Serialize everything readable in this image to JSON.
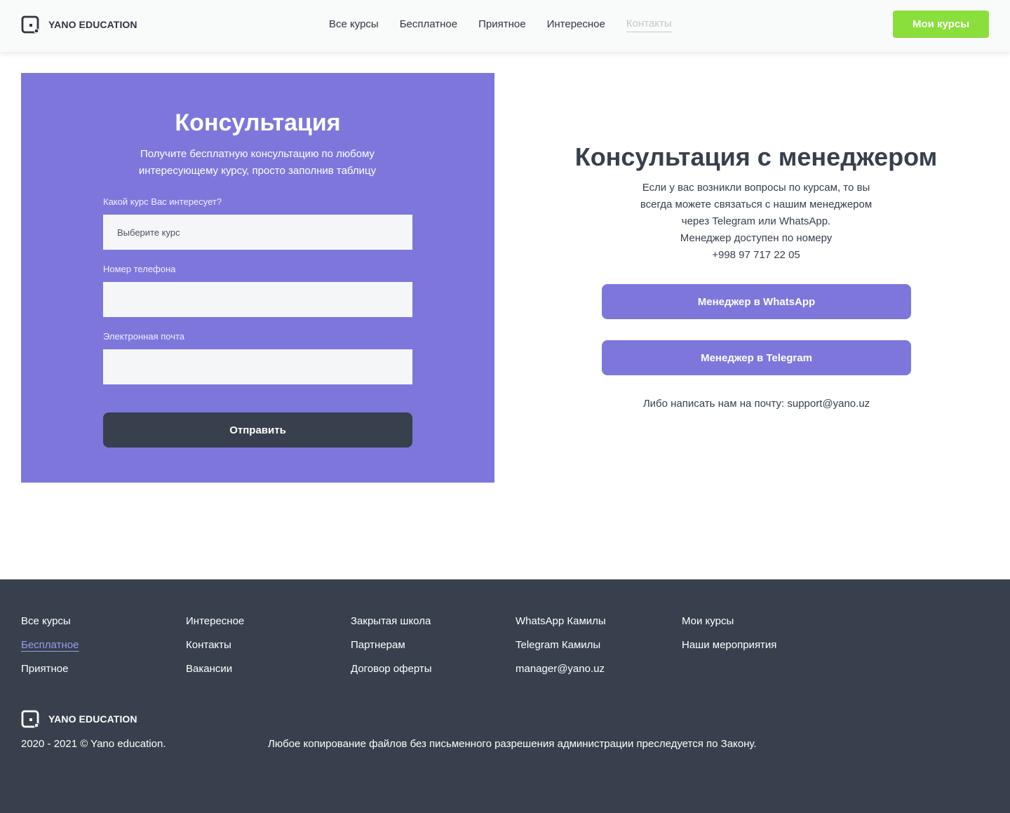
{
  "header": {
    "logo_text": "YANO EDUCATION",
    "nav": [
      {
        "label": "Все курсы"
      },
      {
        "label": "Бесплатное"
      },
      {
        "label": "Приятное"
      },
      {
        "label": "Интересное"
      },
      {
        "label": "Контакты",
        "active": true
      }
    ],
    "my_courses_label": "Мои курсы"
  },
  "form": {
    "title": "Консультация",
    "subtitle": "Получите бесплатную консультацию по любому интересующему курсу, просто заполнив таблицу",
    "course_label": "Какой курс Вас интересует?",
    "course_placeholder": "Выберите курс",
    "phone_label": "Номер телефона",
    "phone_value": "",
    "email_label": "Электронная почта",
    "email_value": "",
    "submit_label": "Отправить"
  },
  "manager": {
    "title": "Консультация с менеджером",
    "text_lines": [
      "Если у вас возникли вопросы по курсам, то вы",
      "всегда можете связаться с нашим менеджером",
      "через Telegram или WhatsApp.",
      "Менеджер доступен по номеру",
      "+998 97 717 22 05"
    ],
    "whatsapp_label": "Менеджер в WhatsApp",
    "telegram_label": "Менеджер в Telegram",
    "mail_text": "Либо написать нам на почту: support@yano.uz"
  },
  "footer": {
    "columns": [
      [
        "Все курсы",
        "Бесплатное",
        "Приятное"
      ],
      [
        "Интересное",
        "Контакты",
        "Вакансии"
      ],
      [
        "Закрытая школа",
        "Партнерам",
        "Договор оферты"
      ],
      [
        "WhatsApp Камилы",
        "Telegram Камилы",
        "manager@yano.uz"
      ],
      [
        "Мои курсы",
        "Наши мероприятия"
      ]
    ],
    "logo_text": "YANO EDUCATION",
    "copyright": "2020 - 2021 © Yano education.",
    "legal": "Любое копирование файлов без письменного разрешения администрации преследуется по Закону."
  },
  "colors": {
    "accent_purple": "#7d77dc",
    "accent_green": "#8adf3d",
    "dark": "#37404c"
  },
  "icons": {
    "logo": "yano-logo-icon"
  }
}
